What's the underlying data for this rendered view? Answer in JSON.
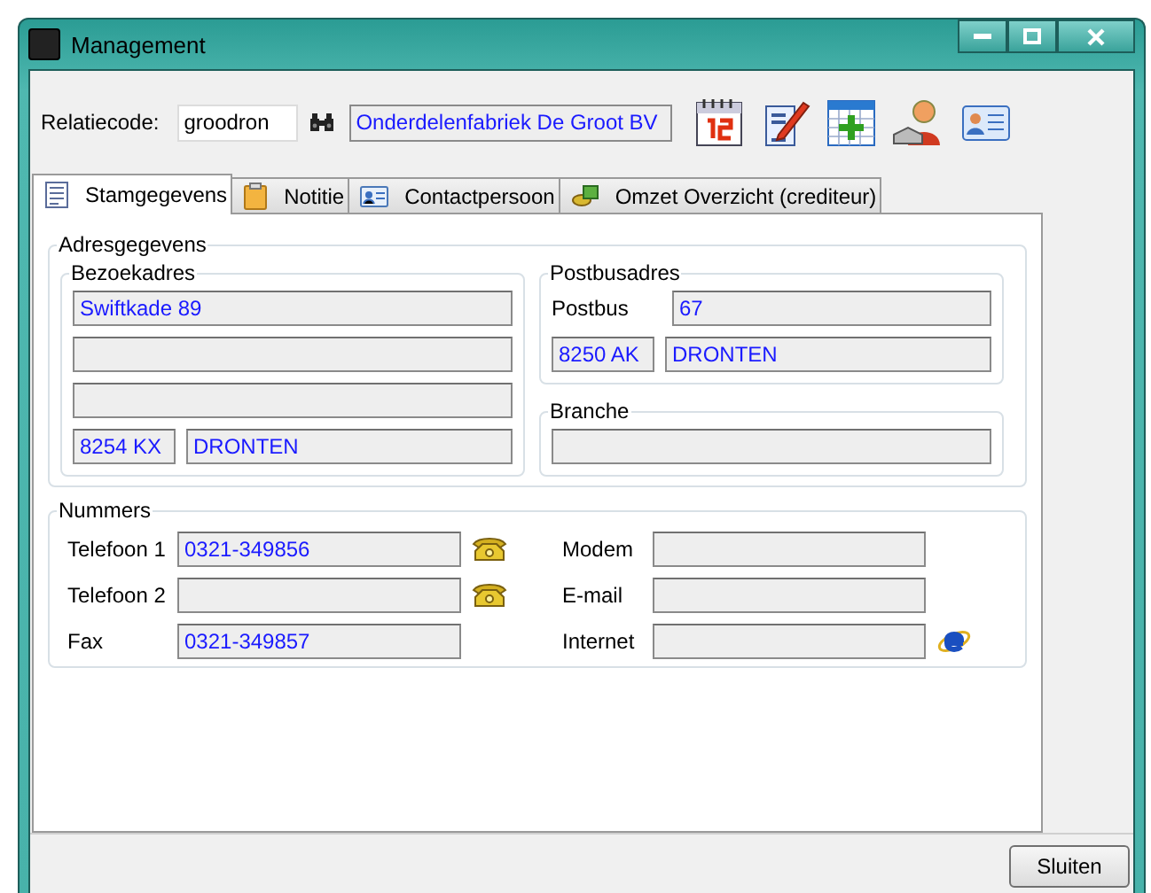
{
  "window": {
    "title": "Management"
  },
  "header": {
    "label": "Relatiecode:",
    "code": "groodron",
    "name": "Onderdelenfabriek De Groot BV"
  },
  "tabs": [
    {
      "label": "Stamgegevens",
      "selected": true
    },
    {
      "label": "Notitie",
      "selected": false
    },
    {
      "label": "Contactpersoon",
      "selected": false
    },
    {
      "label": "Omzet Overzicht (crediteur)",
      "selected": false
    }
  ],
  "address": {
    "title": "Adresgegevens",
    "visit": {
      "title": "Bezoekadres",
      "rows": [
        {
          "kind": "single",
          "value": "Swiftkade 89"
        },
        {
          "kind": "single"
        },
        {
          "kind": "single"
        },
        {
          "kind": "postcode",
          "postcode": "8254 KX",
          "city": "DRONTEN"
        }
      ]
    },
    "postbox": {
      "title": "Postbusadres",
      "rows": [
        {
          "kind": "labeled",
          "label": "Postbus",
          "value": "67"
        },
        {
          "kind": "postcode",
          "postcode": "8250 AK",
          "city": "DRONTEN"
        }
      ]
    },
    "branch": {
      "title": "Branche",
      "rows": [
        {
          "kind": "single"
        }
      ]
    }
  },
  "numbers": {
    "title": "Nummers",
    "left": [
      {
        "kind": "phone",
        "label": "Telefoon 1",
        "value": "0321-349856"
      },
      {
        "kind": "phone",
        "label": "Telefoon 2"
      },
      {
        "kind": "plain",
        "label": "Fax",
        "value": "0321-349857"
      }
    ],
    "right": [
      {
        "kind": "plain",
        "label": "Modem"
      },
      {
        "kind": "plain",
        "label": "E-mail"
      },
      {
        "kind": "web",
        "label": "Internet"
      }
    ]
  },
  "buttons": [
    {
      "label": "Sluiten"
    }
  ]
}
